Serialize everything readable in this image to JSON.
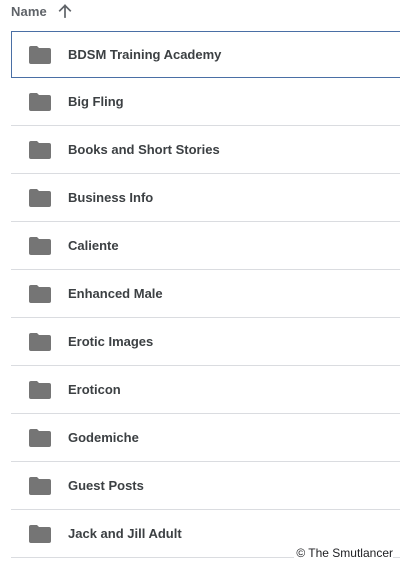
{
  "header": {
    "sort_label": "Name",
    "sort_direction_icon": "arrow-up-icon"
  },
  "files": {
    "items": [
      {
        "name": "BDSM Training Academy",
        "icon": "folder-icon",
        "selected": true
      },
      {
        "name": "Big Fling",
        "icon": "folder-icon"
      },
      {
        "name": "Books and Short Stories",
        "icon": "folder-icon"
      },
      {
        "name": "Business Info",
        "icon": "folder-icon"
      },
      {
        "name": "Caliente",
        "icon": "folder-icon"
      },
      {
        "name": "Enhanced Male",
        "icon": "folder-icon"
      },
      {
        "name": "Erotic Images",
        "icon": "folder-icon"
      },
      {
        "name": "Eroticon",
        "icon": "folder-icon"
      },
      {
        "name": "Godemiche",
        "icon": "folder-icon"
      },
      {
        "name": "Guest Posts",
        "icon": "folder-icon"
      },
      {
        "name": "Jack and Jill Adult",
        "icon": "folder-icon"
      }
    ]
  },
  "watermark": {
    "text": "© The Smutlancer"
  },
  "colors": {
    "folder_icon": "#757575",
    "selection_border": "#4a6fa5",
    "divider": "#dadce0"
  }
}
